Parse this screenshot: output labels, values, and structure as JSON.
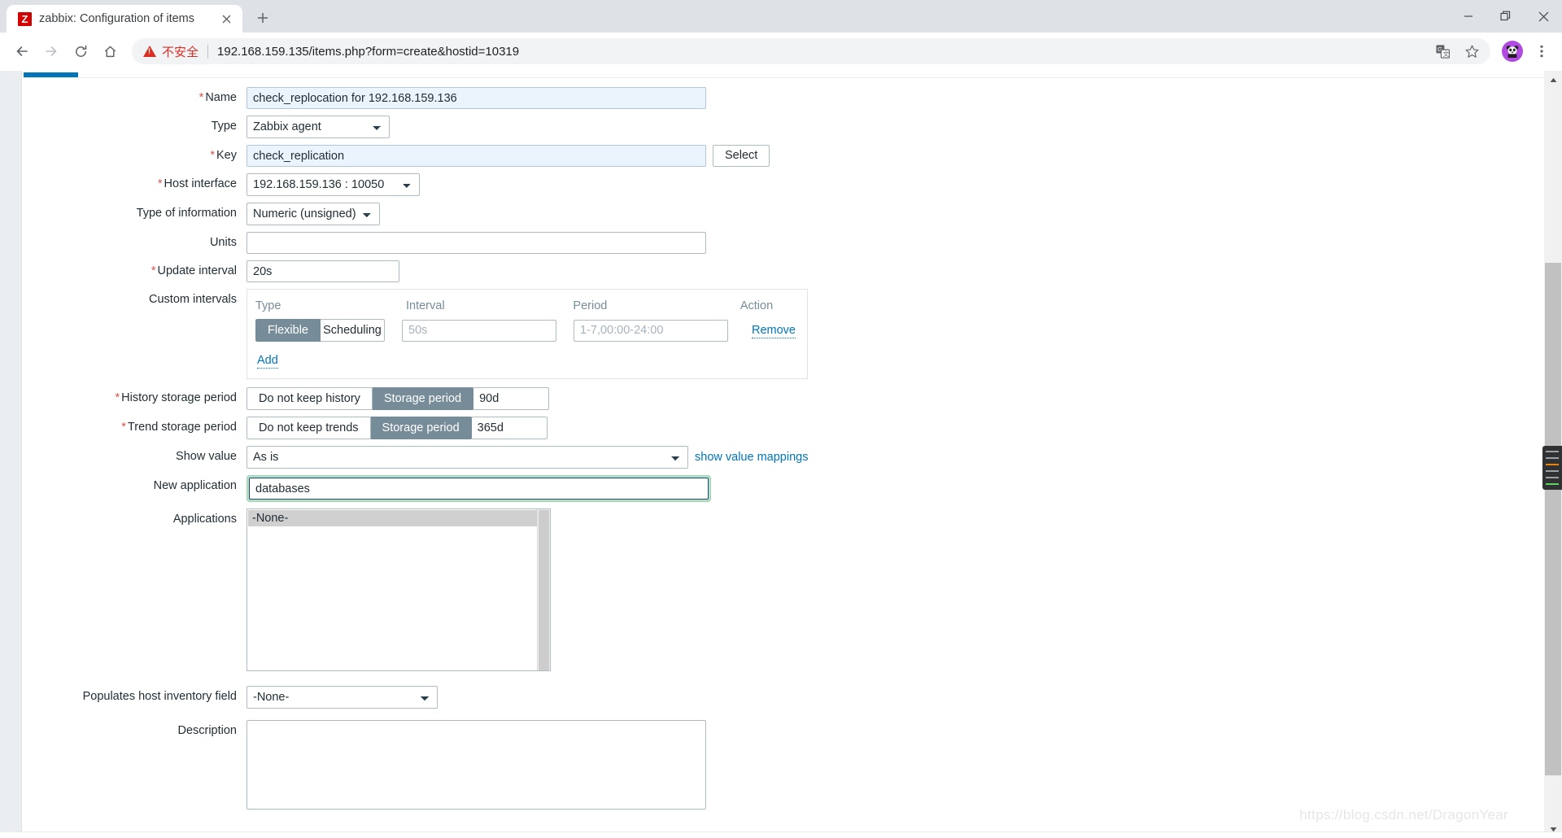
{
  "browser": {
    "tab": {
      "title": "zabbix: Configuration of items",
      "favicon_letter": "Z",
      "favicon_color": "#d40000",
      "close_icon": "close-icon"
    },
    "new_tab_label": "+",
    "window_controls": {
      "minimize": "—",
      "restore": "❐",
      "close": "✕"
    },
    "nav": {
      "back": "←",
      "forward": "→",
      "reload": "↻",
      "home": "⌂"
    },
    "omnibox": {
      "security_label": "不安全",
      "url": "192.168.159.135/items.php?form=create&hostid=10319",
      "translate_icon": "translate-icon",
      "bookmark_icon": "star-icon",
      "profile_icon": "avatar-panda",
      "menu_icon": "three-dot-menu-icon",
      "avatar_color": "#b14ae0"
    }
  },
  "form": {
    "name": {
      "label": "Name",
      "required": true,
      "value": "check_replocation for 192.168.159.136"
    },
    "type": {
      "label": "Type",
      "required": false,
      "value": "Zabbix agent"
    },
    "key": {
      "label": "Key",
      "required": true,
      "value": "check_replication",
      "select_button": "Select"
    },
    "host_interface": {
      "label": "Host interface",
      "required": true,
      "value": "192.168.159.136 : 10050"
    },
    "type_of_information": {
      "label": "Type of information",
      "required": false,
      "value": "Numeric (unsigned)"
    },
    "units": {
      "label": "Units",
      "required": false,
      "value": ""
    },
    "update_interval": {
      "label": "Update interval",
      "required": true,
      "value": "20s"
    },
    "custom_intervals": {
      "label": "Custom intervals",
      "headers": {
        "type": "Type",
        "interval": "Interval",
        "period": "Period",
        "action": "Action"
      },
      "rows": [
        {
          "type_options": [
            "Flexible",
            "Scheduling"
          ],
          "type_selected": "Flexible",
          "interval_value": "",
          "interval_placeholder": "50s",
          "period_value": "",
          "period_placeholder": "1-7,00:00-24:00",
          "remove_label": "Remove"
        }
      ],
      "add_label": "Add"
    },
    "history_storage_period": {
      "label": "History storage period",
      "required": true,
      "options": [
        "Do not keep history",
        "Storage period"
      ],
      "selected": "Storage period",
      "value": "90d"
    },
    "trend_storage_period": {
      "label": "Trend storage period",
      "required": true,
      "options": [
        "Do not keep trends",
        "Storage period"
      ],
      "selected": "Storage period",
      "value": "365d"
    },
    "show_value": {
      "label": "Show value",
      "required": false,
      "value": "As is",
      "link": "show value mappings"
    },
    "new_application": {
      "label": "New application",
      "required": false,
      "value": "databases",
      "focused": true,
      "focus_color": "#b8e0c8"
    },
    "applications": {
      "label": "Applications",
      "items": [
        "-None-"
      ],
      "selected": "-None-"
    },
    "populates_host_inventory_field": {
      "label": "Populates host inventory field",
      "required": false,
      "value": "-None-"
    },
    "description": {
      "label": "Description",
      "required": false,
      "value": ""
    }
  },
  "scrollbar": {
    "up_arrow": "▲",
    "down_arrow": "▼"
  },
  "watermark": "https://blog.csdn.net/DragonYear"
}
